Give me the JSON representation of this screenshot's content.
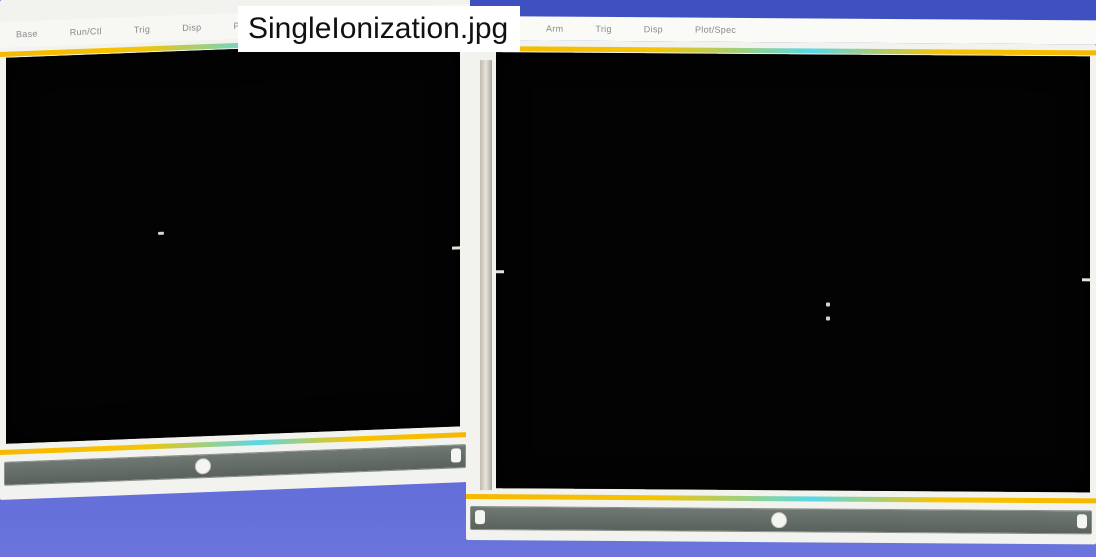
{
  "file_title": "SingleIonization.jpg",
  "left_window": {
    "menu": [
      "Base",
      "Run/Ctl",
      "Trig",
      "Disp",
      "Plot/Spec"
    ]
  },
  "right_window": {
    "menu": [
      "Arm",
      "Trig",
      "Disp",
      "Plot/Spec"
    ]
  },
  "colors": {
    "background": "#4a58c8",
    "display": "#040303",
    "stripe_yellow": "#f6c400",
    "stripe_cyan": "#58d8e8",
    "frame": "#f2f2ee"
  }
}
